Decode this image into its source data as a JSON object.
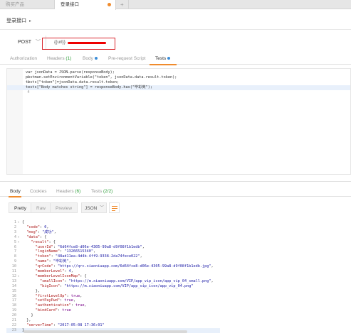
{
  "tabs": [
    {
      "label": "购买产品",
      "active": false
    },
    {
      "label": "登录接口",
      "active": true,
      "unsaved": true
    },
    {
      "label": "+"
    }
  ],
  "request": {
    "name": "登录接口",
    "method": "POST",
    "url": "{{url}}"
  },
  "request_tabs": [
    {
      "label": "Authorization"
    },
    {
      "label": "Headers",
      "count": "(1)"
    },
    {
      "label": "Body",
      "dot": true
    },
    {
      "label": "Pre-request Script"
    },
    {
      "label": "Tests",
      "dot": true,
      "active": true
    }
  ],
  "script": [
    {
      "num": "1",
      "code": "var jsonData = JSON.parse(responseBody);"
    },
    {
      "num": "2",
      "code": "postman.setEnvironmentVariable(\"token\", jsonData.data.result.token);"
    },
    {
      "num": "3",
      "code": "tests[\"token\"]=jsonData.data.result.token;"
    },
    {
      "num": "4",
      "code": "tests[\"Body matches string\"] = responseBody.has(\"毕彩英\");"
    }
  ],
  "response_tabs": [
    {
      "label": "Body",
      "active": true
    },
    {
      "label": "Cookies"
    },
    {
      "label": "Headers",
      "count": "(6)"
    },
    {
      "label": "Tests",
      "count": "(2/2)"
    }
  ],
  "response_toolbar": {
    "pretty": "Pretty",
    "raw": "Raw",
    "preview": "Preview",
    "format": "JSON"
  },
  "response_lines": [
    {
      "num": "1",
      "fold": "▾",
      "code": "{"
    },
    {
      "num": "2",
      "fold": "",
      "code": "  \"code\": 0,"
    },
    {
      "num": "3",
      "fold": "",
      "code": "  \"msg\": \"成功\","
    },
    {
      "num": "4",
      "fold": "▾",
      "code": "  \"data\": {"
    },
    {
      "num": "5",
      "fold": "▾",
      "code": "    \"result\": {"
    },
    {
      "num": "6",
      "fold": "",
      "code": "      \"userId\": \"6d64fce8-d06e-4305-99a8-d9f08f1b1edb\","
    },
    {
      "num": "7",
      "fold": "",
      "code": "      \"loginName\": \"13266515340\","
    },
    {
      "num": "8",
      "fold": "",
      "code": "      \"token\": \"48ad11ea-4d4b-4ff9-9338-2da74fece022\","
    },
    {
      "num": "9",
      "fold": "",
      "code": "      \"name\": \"毕彩英\","
    },
    {
      "num": "10",
      "fold": "",
      "code": "      \"qrCode\": \"https://qrc.xiaoniuapp.com/6d64fce8-d06e-4305-99a8-d9f08f1b1edb.jpg\","
    },
    {
      "num": "11",
      "fold": "",
      "code": "      \"memberLevel\": 4,"
    },
    {
      "num": "12",
      "fold": "▾",
      "code": "      \"memberLevelIconMap\": {"
    },
    {
      "num": "13",
      "fold": "",
      "code": "        \"smallIcon\": \"https://m.xiaoniuapp.com/VIP/app_vip_icon/app_vip_04_small.png\","
    },
    {
      "num": "14",
      "fold": "",
      "code": "        \"bigIcon\": \"https://m.xiaoniuapp.com/VIP/app_vip_icon/app_vip_04.png\""
    },
    {
      "num": "15",
      "fold": "",
      "code": "      },"
    },
    {
      "num": "16",
      "fold": "",
      "code": "      \"firstLevelUp\": true,"
    },
    {
      "num": "17",
      "fold": "",
      "code": "      \"setPayPwd\": true,"
    },
    {
      "num": "18",
      "fold": "",
      "code": "      \"authentication\": true,"
    },
    {
      "num": "19",
      "fold": "",
      "code": "      \"bindCard\": true"
    },
    {
      "num": "20",
      "fold": "",
      "code": "    }"
    },
    {
      "num": "21",
      "fold": "",
      "code": "  },"
    },
    {
      "num": "22",
      "fold": "",
      "code": "  \"serverTime\": \"2017-05-08 17:36:01\""
    },
    {
      "num": "23",
      "fold": "",
      "code": "}"
    }
  ],
  "colors": {
    "accent": "#f08b2c",
    "highlight_box": "#d9262d",
    "count_green": "#2f9e3a",
    "dot_blue": "#3b8dd8"
  }
}
